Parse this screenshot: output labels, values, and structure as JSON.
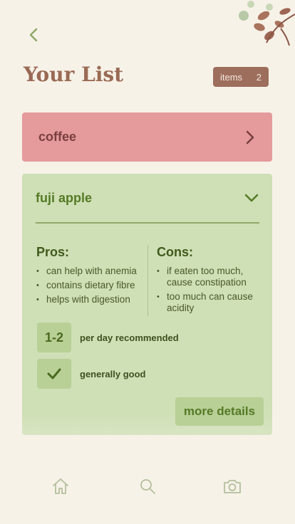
{
  "header": {
    "title": "Your List",
    "items_label": "items",
    "items_count": "2"
  },
  "list": [
    {
      "name": "coffee",
      "expanded": false
    },
    {
      "name": "fuji apple",
      "expanded": true,
      "pros_heading": "Pros:",
      "pros": [
        "can help with anemia",
        "contains dietary fibre",
        "helps with digestion"
      ],
      "cons_heading": "Cons:",
      "cons": [
        "if eaten too much, cause constipation",
        "too much can cause acidity"
      ],
      "serving_value": "1-2",
      "serving_text": "per day recommended",
      "verdict_text": "generally good",
      "more_label": "more details"
    }
  ],
  "nav": {
    "home": "home-icon",
    "search": "search-icon",
    "camera": "camera-icon"
  },
  "colors": {
    "background": "#f7f2e8",
    "coffee_card": "#e59a9b",
    "apple_card": "#cfdfb6",
    "badge": "#9d6e5c"
  }
}
